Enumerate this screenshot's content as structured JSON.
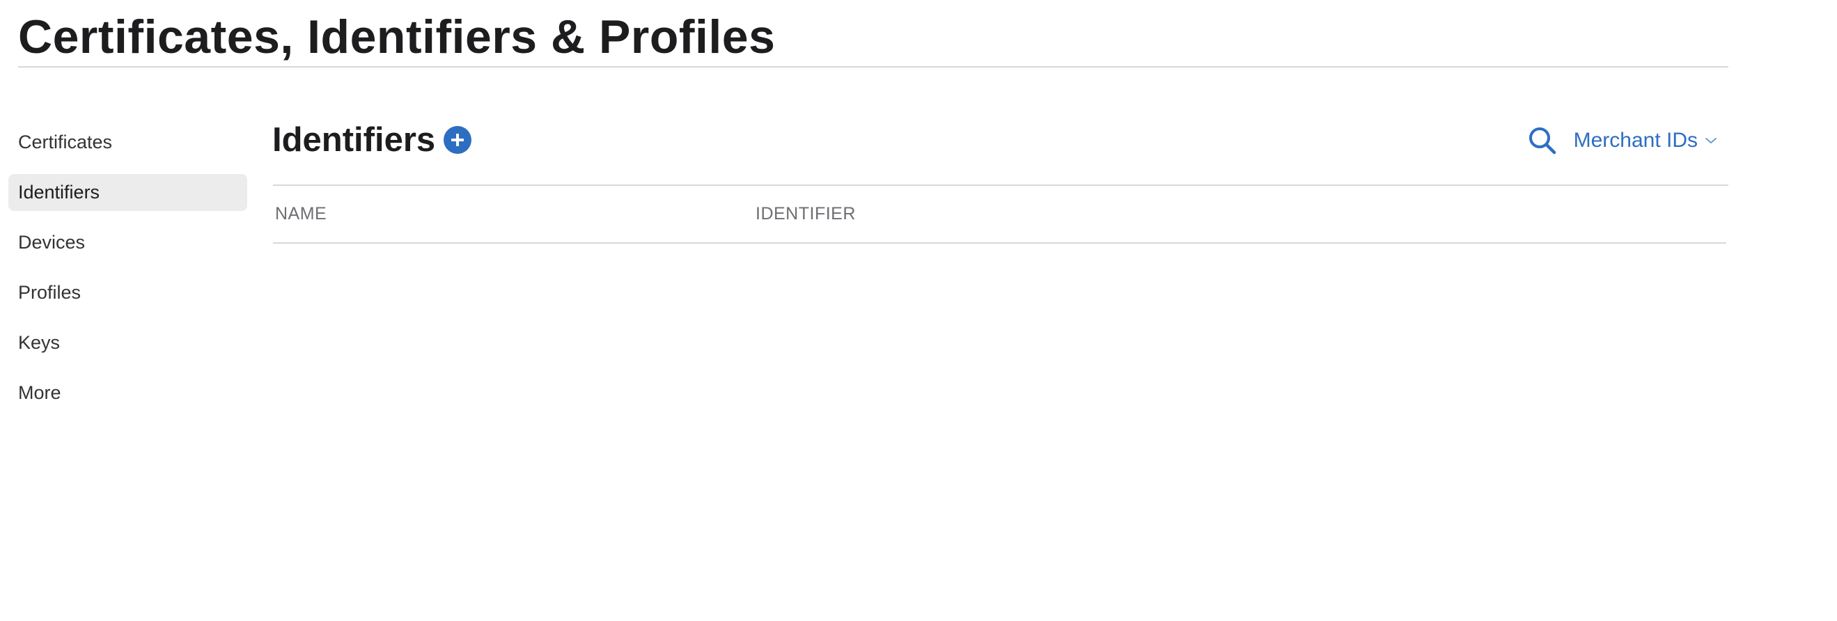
{
  "page": {
    "title": "Certificates, Identifiers & Profiles"
  },
  "sidebar": {
    "items": [
      {
        "label": "Certificates",
        "active": false
      },
      {
        "label": "Identifiers",
        "active": true
      },
      {
        "label": "Devices",
        "active": false
      },
      {
        "label": "Profiles",
        "active": false
      },
      {
        "label": "Keys",
        "active": false
      },
      {
        "label": "More",
        "active": false
      }
    ]
  },
  "main": {
    "section_title": "Identifiers",
    "add_icon": "plus-circle-icon",
    "search_icon": "search-icon",
    "filter": {
      "selected": "Merchant IDs",
      "icon": "chevron-down-icon"
    },
    "table": {
      "columns": [
        "NAME",
        "IDENTIFIER"
      ],
      "rows": []
    }
  },
  "colors": {
    "accent": "#2d6ec2",
    "text": "#1d1d1f",
    "active_bg": "#ececec",
    "divider": "#d8d8d8",
    "muted": "#6e6e73"
  }
}
